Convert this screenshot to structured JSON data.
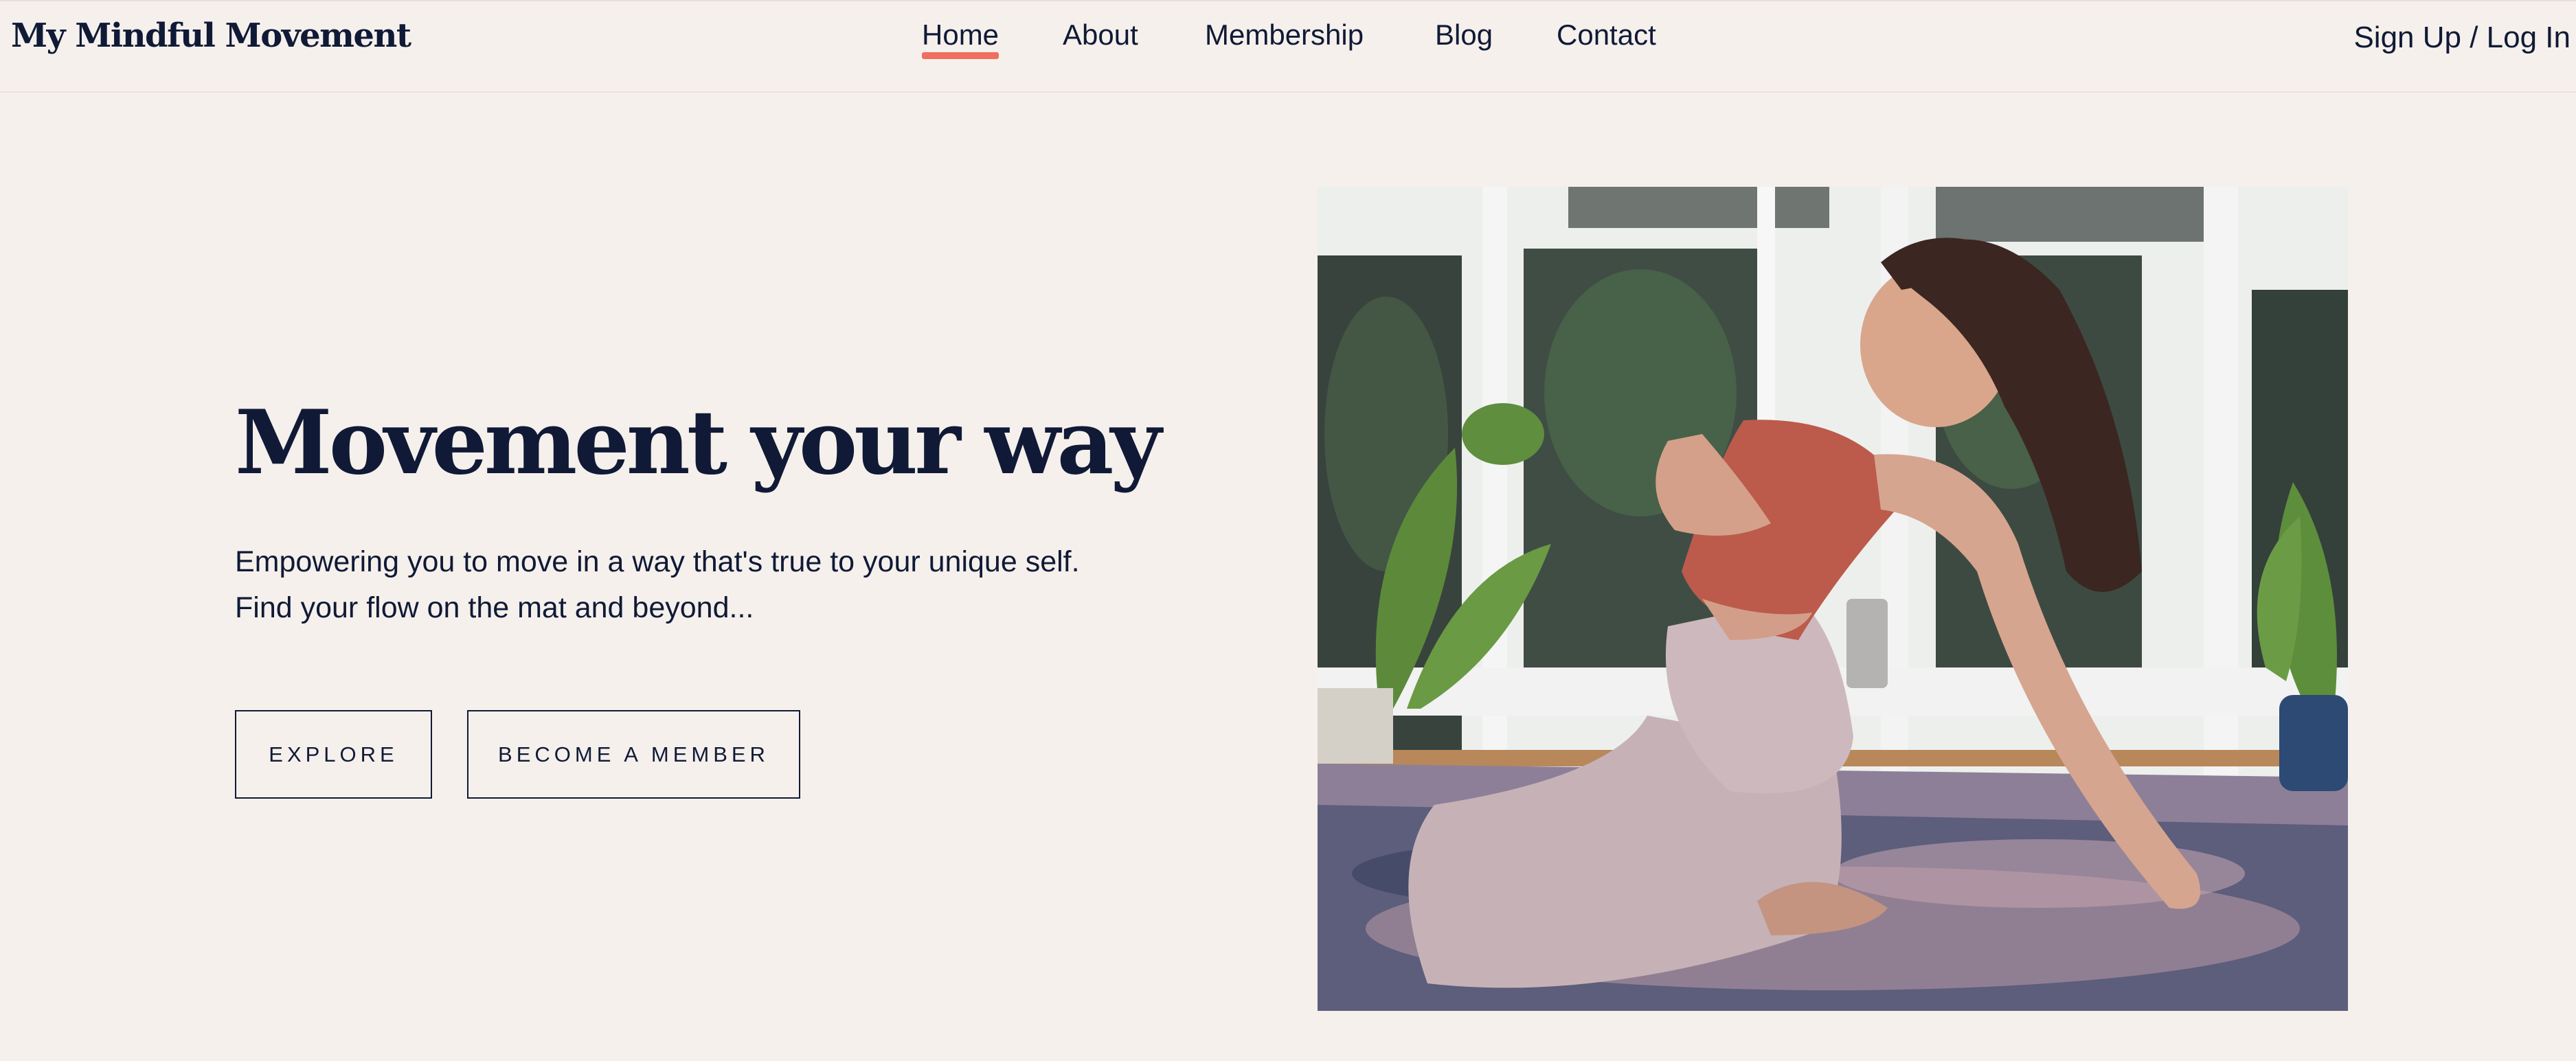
{
  "header": {
    "logo": "My Mindful Movement",
    "nav": [
      {
        "label": "Home",
        "active": true
      },
      {
        "label": "About",
        "active": false
      },
      {
        "label": "Membership",
        "active": false
      },
      {
        "label": "Blog",
        "active": false
      },
      {
        "label": "Contact",
        "active": false
      }
    ],
    "auth_link": "Sign Up / Log In"
  },
  "hero": {
    "title_main": "Movement ",
    "title_accent": "your way",
    "subtitle_line1": "Empowering you to move in a way that's true to your unique self.",
    "subtitle_line2": "Find your flow on the mat and beyond...",
    "buttons": {
      "explore": "EXPLORE",
      "member": "BECOME A MEMBER"
    },
    "image": {
      "subject": "yoga-photo"
    }
  },
  "colors": {
    "background": "#f5f0ec",
    "text": "#101a36",
    "nav_active_underline": "#ef6e5f",
    "title_accent_underline": "#4f8a86"
  }
}
